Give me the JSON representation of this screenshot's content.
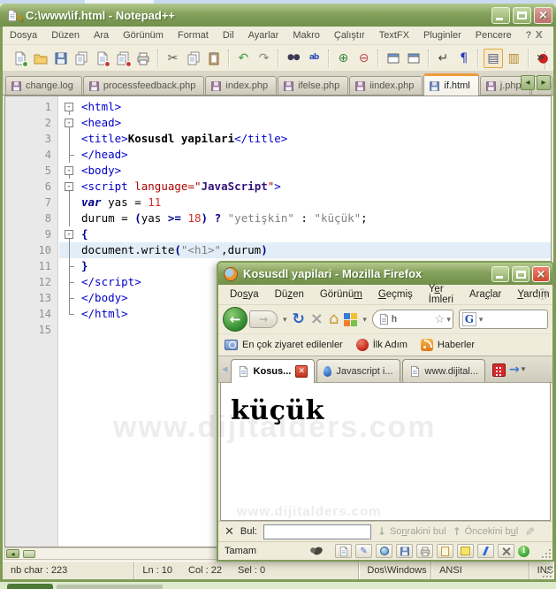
{
  "watermark": "www.dijitalders.com",
  "notepadpp": {
    "title": "C:\\www\\if.html - Notepad++",
    "menus": [
      "Dosya",
      "Düzen",
      "Ara",
      "Görünüm",
      "Format",
      "Dil",
      "Ayarlar",
      "Makro",
      "Çalıştır",
      "TextFX",
      "Pluginler",
      "Pencere",
      "?"
    ],
    "menu_close_glyph": "X",
    "toolbar_overflow_glyph": "»",
    "toolbar": [
      {
        "name": "new-file",
        "svg": "page",
        "badge": "green"
      },
      {
        "name": "open-file",
        "svg": "folder"
      },
      {
        "name": "save",
        "svg": "floppy"
      },
      {
        "name": "save-all",
        "svg": "pages"
      },
      {
        "name": "close",
        "svg": "page",
        "badge": "red"
      },
      {
        "name": "close-all",
        "svg": "pages",
        "badge": "red"
      },
      {
        "name": "print",
        "svg": "printer",
        "sep": true
      },
      {
        "name": "cut",
        "glyph": "✂",
        "color": "#55554d"
      },
      {
        "name": "copy",
        "svg": "pages"
      },
      {
        "name": "paste",
        "svg": "clipboard",
        "sep": true
      },
      {
        "name": "undo",
        "glyph": "↶",
        "color": "#3f9d3f"
      },
      {
        "name": "redo",
        "glyph": "↷",
        "color": "#88887e",
        "sep": true
      },
      {
        "name": "find",
        "glyph": "●●",
        "color": "#3a3a52",
        "small": true
      },
      {
        "name": "replace",
        "glyph": "ab",
        "color": "#2a4ab8",
        "small": true,
        "sep": true
      },
      {
        "name": "zoom-in",
        "glyph": "⊕",
        "color": "#3a8a3a"
      },
      {
        "name": "zoom-out",
        "glyph": "⊖",
        "color": "#c04848",
        "sep": true
      },
      {
        "name": "sync-vertical-scroll",
        "svg": "window"
      },
      {
        "name": "sync-horizontal-scroll",
        "svg": "window",
        "sep": true
      },
      {
        "name": "word-wrap",
        "glyph": "↵",
        "color": "#4a4a42"
      },
      {
        "name": "show-all-characters",
        "glyph": "¶",
        "color": "#2a3ab8",
        "sep": true
      },
      {
        "name": "indent-guide",
        "glyph": "▤",
        "color": "#4a5a8a",
        "selected": true
      },
      {
        "name": "doc-switcher",
        "glyph": "▥",
        "color": "#b8862a",
        "sep": true
      },
      {
        "name": "record-macro",
        "glyph": "●",
        "color": "#cc2222"
      }
    ],
    "tabs": [
      {
        "label": "change.log"
      },
      {
        "label": "processfeedback.php"
      },
      {
        "label": "index.php"
      },
      {
        "label": "ifelse.php"
      },
      {
        "label": "iindex.php"
      },
      {
        "label": "if.html",
        "active": true
      },
      {
        "label": "j.php"
      },
      {
        "label": "i",
        "partial": true
      }
    ],
    "code": {
      "lines": [
        {
          "f": "box",
          "segs": [
            [
              "t",
              "<html>"
            ]
          ]
        },
        {
          "f": "box",
          "segs": [
            [
              "t",
              "<head>"
            ]
          ]
        },
        {
          "f": "line",
          "segs": [
            [
              "t",
              "<title>"
            ],
            [
              "b",
              "Kosusdl yapilari"
            ],
            [
              "t",
              "</title>"
            ]
          ]
        },
        {
          "f": "tick",
          "segs": [
            [
              "t",
              "</head>"
            ]
          ]
        },
        {
          "f": "box",
          "segs": [
            [
              "t",
              "<body>"
            ]
          ]
        },
        {
          "f": "box",
          "segs": [
            [
              "t",
              "<script "
            ],
            [
              "a",
              "language"
            ],
            [
              "q",
              "=\""
            ],
            [
              "v",
              "JavaScript"
            ],
            [
              "q",
              "\""
            ],
            [
              "t",
              ">"
            ]
          ]
        },
        {
          "f": "line",
          "segs": [
            [
              "k",
              "var"
            ],
            [
              "p",
              " yas = "
            ],
            [
              "n",
              "11"
            ]
          ]
        },
        {
          "f": "line",
          "segs": [
            [
              "p",
              "durum = "
            ],
            [
              "o",
              "("
            ],
            [
              "p",
              "yas "
            ],
            [
              "o",
              ">="
            ],
            [
              "p",
              " "
            ],
            [
              "n",
              "18"
            ],
            [
              "o",
              ")"
            ],
            [
              "p",
              " "
            ],
            [
              "o",
              "?"
            ],
            [
              "p",
              " "
            ],
            [
              "s",
              "\"yetişkin\""
            ],
            [
              "p",
              " : "
            ],
            [
              "s",
              "\"küçük\""
            ],
            [
              "p",
              ";"
            ]
          ]
        },
        {
          "f": "box",
          "segs": [
            [
              "o",
              "{"
            ]
          ]
        },
        {
          "f": "line",
          "hl": true,
          "segs": [
            [
              "p",
              "document.write"
            ],
            [
              "o",
              "("
            ],
            [
              "s",
              "\"<h1>\""
            ],
            [
              "p",
              ",durum"
            ],
            [
              "o",
              ")"
            ]
          ]
        },
        {
          "f": "tick",
          "segs": [
            [
              "o",
              "}"
            ]
          ]
        },
        {
          "f": "tick",
          "segs": [
            [
              "t",
              "</script>"
            ]
          ]
        },
        {
          "f": "tick",
          "segs": [
            [
              "t",
              "</body>"
            ]
          ]
        },
        {
          "f": "end",
          "segs": [
            [
              "t",
              "</html>"
            ]
          ]
        },
        {
          "f": "none",
          "segs": []
        }
      ]
    },
    "status": {
      "chars": "nb char : 223",
      "ln": "Ln : 10",
      "col": "Col : 22",
      "sel": "Sel : 0",
      "eol": "Dos\\Windows",
      "encoding": "ANSI",
      "insert_mode": "INS"
    }
  },
  "firefox": {
    "title": "Kosusdl yapilari - Mozilla Firefox",
    "menus": [
      {
        "pre": "Do",
        "key": "s",
        "post": "ya"
      },
      {
        "pre": "Dü",
        "key": "z",
        "post": "en"
      },
      {
        "pre": "Görünü",
        "key": "m",
        "post": ""
      },
      {
        "pre": "",
        "key": "G",
        "post": "eçmiş"
      },
      {
        "pre": "Y",
        "key": "e",
        "post": "r İmleri"
      },
      {
        "pre": "Ara",
        "key": "ç",
        "post": "lar"
      },
      {
        "pre": "",
        "key": "Y",
        "post": "ardım"
      }
    ],
    "nav": {
      "back_glyph": "←",
      "forward_glyph": "→",
      "reload_glyph": "↻",
      "stop_glyph": "×",
      "home_glyph": "⌂",
      "urlbar_text": "h",
      "star_glyph": "☆",
      "google_logo": "G"
    },
    "bookmarks": [
      {
        "label": "En çok ziyaret edilenler",
        "icon": "folder-search"
      },
      {
        "label": "İlk Adım",
        "icon": "red-globe"
      },
      {
        "label": "Haberler",
        "icon": "rss"
      }
    ],
    "tabs": [
      {
        "label": "Kosus...",
        "active": true,
        "icon": "page",
        "closable": true
      },
      {
        "label": "Javascript i...",
        "icon": "blue"
      },
      {
        "label": "www.dijital...",
        "icon": "page"
      }
    ],
    "content": {
      "heading": "küçük"
    },
    "findbar": {
      "close_glyph": "✕",
      "label": "Bul:",
      "next": {
        "pre": "So",
        "key": "n",
        "post": "rakini bul"
      },
      "prev": {
        "pre": "Öncekini b",
        "key": "u",
        "post": "l"
      }
    },
    "statusbar": {
      "text": "Tamam",
      "icons": [
        {
          "name": "bug",
          "type": "bug"
        },
        {
          "name": "new-page",
          "svg": "page"
        },
        {
          "name": "edit",
          "glyph": "✎",
          "color": "#4a6ad0"
        },
        {
          "name": "view-source-globe",
          "type": "globe"
        },
        {
          "name": "save-page",
          "svg": "floppy"
        },
        {
          "name": "print-page",
          "svg": "printer"
        },
        {
          "name": "note",
          "type": "note"
        },
        {
          "name": "sticky-note",
          "type": "sticky"
        },
        {
          "name": "lightning",
          "type": "bolt"
        },
        {
          "name": "tools",
          "type": "tools"
        },
        {
          "name": "info",
          "type": "info"
        }
      ]
    }
  }
}
